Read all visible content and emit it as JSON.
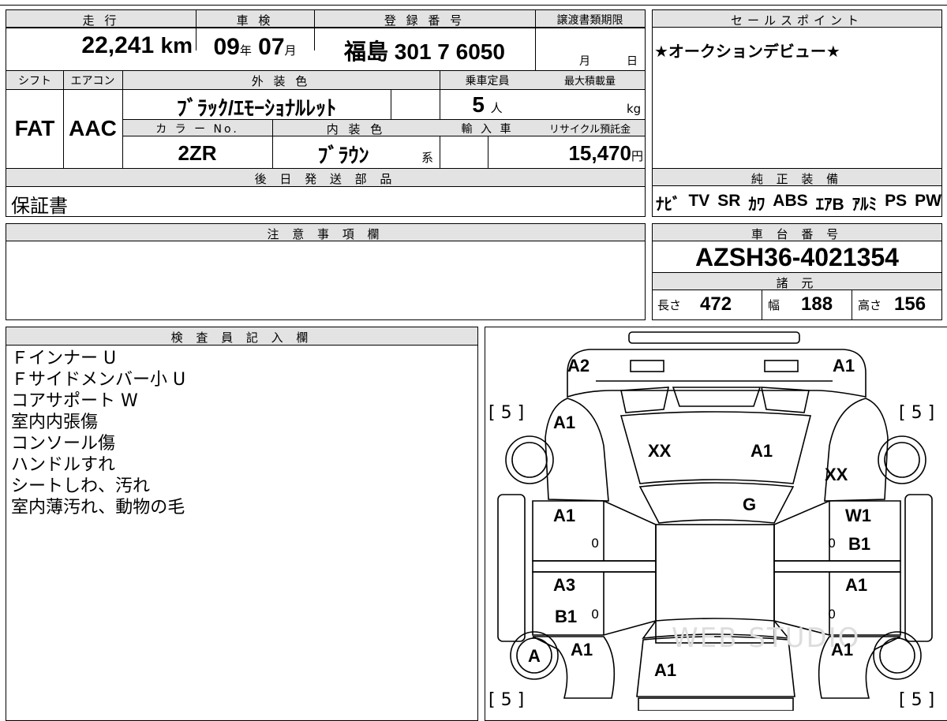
{
  "left_box": {
    "mileage_label": "走 行",
    "mileage_value": "22,241",
    "mileage_unit": "km",
    "inspection_label": "車 検",
    "inspection_year": "09",
    "year_unit": "年",
    "inspection_month": "07",
    "month_unit": "月",
    "registration_label": "登 録 番 号",
    "registration_value": "福島 301 7 6050",
    "transfer_label": "譲渡書類期限",
    "transfer_month_unit": "月",
    "transfer_day_unit": "日",
    "shift_label": "シフト",
    "shift_value": "FAT",
    "ac_label": "エアコン",
    "ac_value": "AAC",
    "ext_color_label": "外 装 色",
    "ext_color_value": "ﾌﾞﾗｯｸ/ｴﾓｰｼｮﾅﾙﾚｯﾄ",
    "capacity_label": "乗車定員",
    "capacity_value": "5",
    "capacity_unit": "人",
    "max_load_label": "最大積載量",
    "max_load_unit": "kg",
    "color_no_label": "カ ラ ー No.",
    "color_no_value": "2ZR",
    "int_color_label": "内 装 色",
    "int_color_value": "ﾌﾞﾗｳﾝ",
    "int_color_suffix": "系",
    "import_label": "輸 入 車",
    "recycle_label": "リサイクル預託金",
    "recycle_value": "15,470",
    "recycle_unit": "円",
    "parts_label": "後 日 発 送 部 品",
    "parts_value": "保証書"
  },
  "sales_point": {
    "label": "セールスポイント",
    "text": "★オークションデビュー★"
  },
  "equipment": {
    "label": "純 正 装 備",
    "items": [
      "ﾅﾋﾞ",
      "TV",
      "SR",
      "ｶﾜ",
      "ABS",
      "ｴｱB",
      "ｱﾙﾐ",
      "PS",
      "PW"
    ]
  },
  "notes": {
    "label": "注 意 事 項 欄"
  },
  "chassis": {
    "label": "車 台 番 号",
    "value": "AZSH36-4021354",
    "spec_label": "諸 元",
    "length_label": "長さ",
    "length_value": "472",
    "width_label": "幅",
    "width_value": "188",
    "height_label": "高さ",
    "height_value": "156"
  },
  "inspector": {
    "label": "検 査 員 記 入 欄",
    "lines": [
      "Ｆインナー U",
      "Ｆサイドメンバー小 U",
      "コアサポート W",
      "室内内張傷",
      "コンソール傷",
      "ハンドルすれ",
      "シートしわ、汚れ",
      "室内薄汚れ、動物の毛"
    ]
  },
  "diagram": {
    "watermark": "WEB STUDIO",
    "tire_tl": "[ 5 ]",
    "tire_tr": "[ 5 ]",
    "tire_bl": "[ 5 ]",
    "tire_br": "[ 5 ]",
    "marks": {
      "front_bumper_left": "A2",
      "front_bumper_right": "A1",
      "front_fender_left": "A1",
      "hood_left": "XX",
      "hood_right": "A1",
      "front_fender_right": "XX",
      "windshield": "G",
      "front_door_left": "A1",
      "front_door_right_1": "W1",
      "front_door_right_2": "B1",
      "rear_door_left_1": "A3",
      "rear_door_left_2": "B1",
      "rear_door_right": "A1",
      "rear_wheel_left": "A",
      "rear_fender_left": "A1",
      "rear_fender_right": "A1",
      "trunk": "A1",
      "zero_1": "0",
      "zero_2": "0",
      "zero_3": "0",
      "zero_4": "0"
    }
  }
}
